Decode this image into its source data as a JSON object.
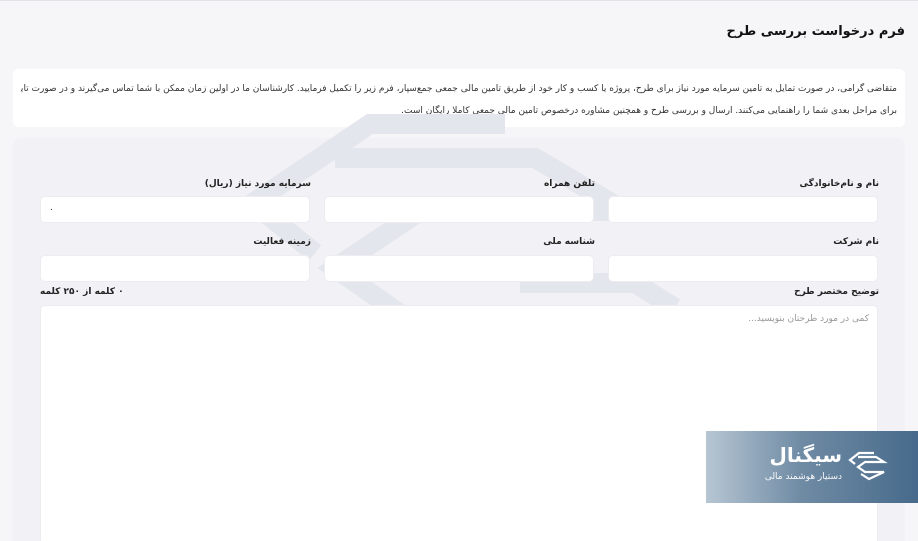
{
  "page": {
    "title": "فرم درخواست بررسی طرح",
    "intro_line1": "متقاضی گرامی، در صورت تمایل به تامین سرمایه مورد نیاز برای طرح، پروژه یا کسب و کار خود از طریق تامین مالی جمعی جمع‌سپار، فرم زیر را تکمیل فرمایید. کارشناسان ما در اولین زمان ممکن با شما تماس می‌گیرند و در صورت تایید اولیه طرح",
    "intro_line2": "برای مراحل بعدی شما را راهنمایی می‌کنند. ارسال و بررسی طرح و همچنین مشاوره درخصوص تامین مالی جمعی کاملا رایگان است."
  },
  "form": {
    "full_name_label": "نام و نام‌خانوادگی",
    "full_name_value": "",
    "phone_label": "تلفن همراه",
    "phone_value": "",
    "capital_label": "سرمایه مورد نیاز (ریال)",
    "capital_value": "۰",
    "company_label": "نام شرکت",
    "company_value": "",
    "national_id_label": "شناسه ملی",
    "national_id_value": "",
    "activity_label": "زمینه فعالیت",
    "activity_value": "",
    "description_label": "توضیح مختصر طرح",
    "description_placeholder": "کمی در مورد طرحتان بنویسید...",
    "word_counter": "۰ کلمه از ۲۵۰ کلمه"
  },
  "brand": {
    "name": "سیگنال",
    "tagline": "دستیار هوشمند مالی",
    "logo_icon": "signal-logo-icon",
    "watermark_icon": "signal-watermark-icon",
    "color_dark": "#476a8b",
    "color_light": "#b7c6d3"
  }
}
